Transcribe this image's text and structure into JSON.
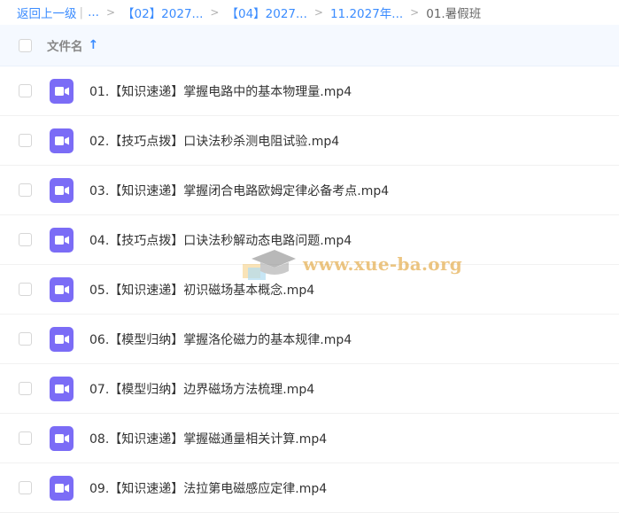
{
  "breadcrumb": {
    "back_label": "返回上一级",
    "separator_bar": "|",
    "ellipsis": "...",
    "crumbs": [
      "【02】2027...",
      "【04】2027...",
      "11.2027年..."
    ],
    "current": "01.暑假班",
    "arrow": ">"
  },
  "header": {
    "filename_label": "文件名",
    "sort_arrow": "↑"
  },
  "files": [
    {
      "name": "01.【知识速递】掌握电路中的基本物理量.mp4"
    },
    {
      "name": "02.【技巧点拨】口诀法秒杀测电阻试验.mp4"
    },
    {
      "name": "03.【知识速递】掌握闭合电路欧姆定律必备考点.mp4"
    },
    {
      "name": "04.【技巧点拨】口诀法秒解动态电路问题.mp4"
    },
    {
      "name": "05.【知识速递】初识磁场基本概念.mp4"
    },
    {
      "name": "06.【模型归纳】掌握洛伦磁力的基本规律.mp4"
    },
    {
      "name": "07.【模型归纳】边界磁场方法梳理.mp4"
    },
    {
      "name": "08.【知识速递】掌握磁通量相关计算.mp4"
    },
    {
      "name": "09.【知识速递】法拉第电磁感应定律.mp4"
    }
  ],
  "watermark": {
    "text": "www.xue-ba.org"
  },
  "icons": {
    "file_icon": "video-file-icon",
    "file_icon_color": "#7b6cf6",
    "accent": "#3b8cff"
  }
}
